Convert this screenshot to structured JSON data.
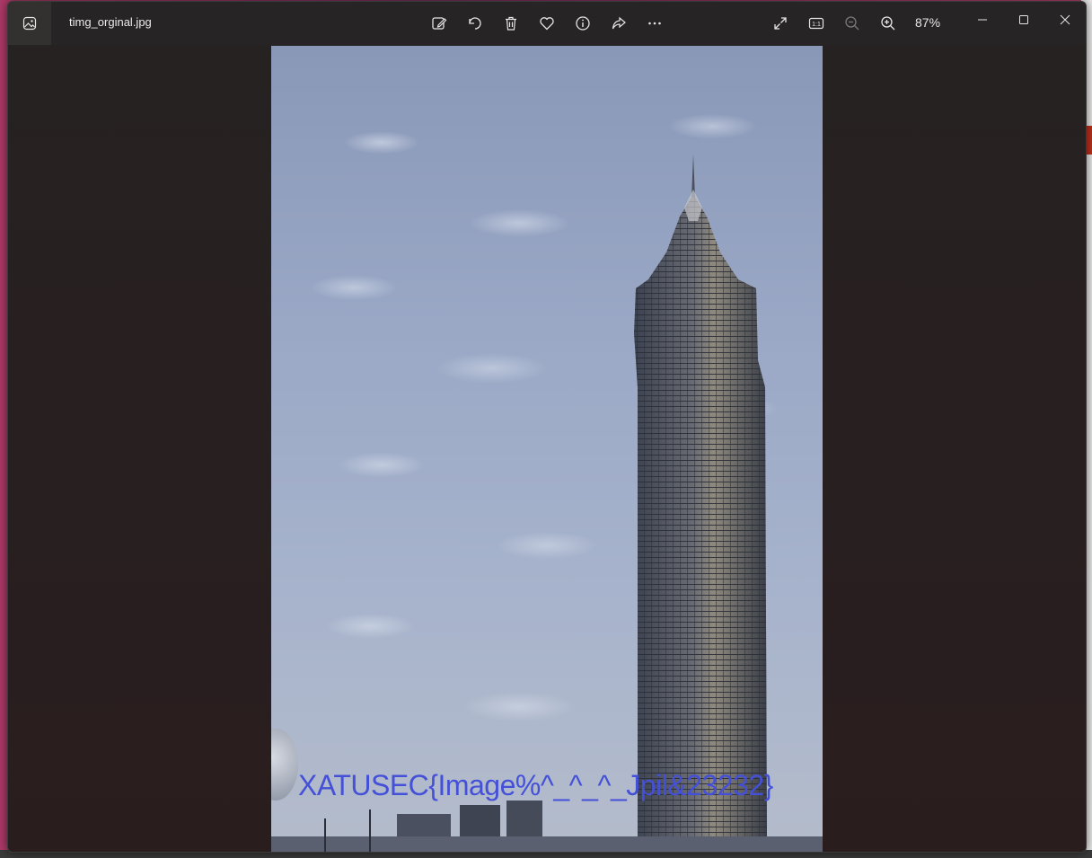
{
  "desktop": {},
  "window": {
    "file_name": "timg_orginal.jpg",
    "zoom_level": "87%",
    "toolbar": [
      {
        "name": "edit-image-icon"
      },
      {
        "name": "rotate-icon"
      },
      {
        "name": "delete-icon"
      },
      {
        "name": "favorite-icon"
      },
      {
        "name": "info-icon"
      },
      {
        "name": "share-icon"
      },
      {
        "name": "more-icon"
      }
    ],
    "view_controls": [
      {
        "name": "full-screen-icon"
      },
      {
        "name": "actual-size-icon",
        "text": "1:1"
      },
      {
        "name": "zoom-out-icon"
      },
      {
        "name": "zoom-in-icon"
      }
    ],
    "window_controls": [
      "minimize",
      "maximize",
      "close"
    ]
  },
  "photo": {
    "overlay_text": "XATUSEC{Image%^_^_^_Jpil&23232}"
  }
}
